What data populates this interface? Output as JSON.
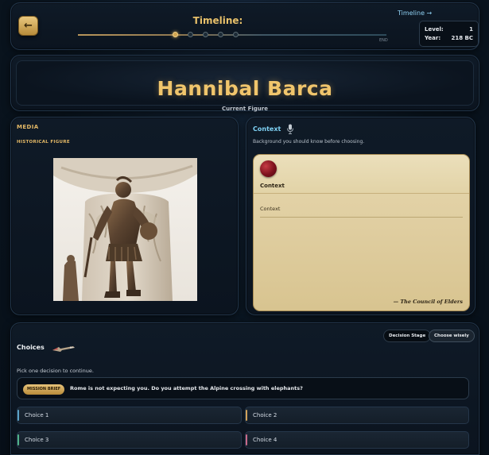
{
  "header": {
    "back_icon": "back-arrow-icon",
    "back_glyph": "←",
    "timeline_title": "Timeline:",
    "timeline_end": "END",
    "timeline_link": "Timeline →",
    "timeline_current_index": 0,
    "level_label": "Level:",
    "level_value": "1",
    "year_label": "Year:",
    "year_value": "218 BC"
  },
  "hero": {
    "name": "Hannibal Barca",
    "subtitle": "Current Figure"
  },
  "media": {
    "title": "MEDIA",
    "subtitle": "HISTORICAL FIGURE",
    "image_subject": "bronze statue of Hannibal Barca"
  },
  "context": {
    "title": "Context",
    "icon": "microphone-icon",
    "description": "Background you should know before choosing.",
    "card_title": "Context",
    "card_body": "Context",
    "signature": "— The Council of Elders",
    "seal_color": "#8e1522"
  },
  "choices": {
    "title": "Choices",
    "icon": "arrow-icon",
    "stage_label": "Decision Stage",
    "hint_label": "Choose wisely",
    "instruction": "Pick one decision to continue.",
    "brief_badge": "MISSION BRIEF",
    "brief_text": "Rome is not expecting you. Do you attempt the Alpine crossing with elephants?",
    "options": [
      {
        "label": "Choice 1",
        "accent": "#5aa2c8"
      },
      {
        "label": "Choice 2",
        "accent": "#d1a25a"
      },
      {
        "label": "Choice 3",
        "accent": "#4fb38a"
      },
      {
        "label": "Choice 4",
        "accent": "#c86a8a"
      }
    ]
  },
  "colors": {
    "accent_gold": "#f0c56c",
    "accent_cyan": "#7fd3f6",
    "background": "#0a1520"
  }
}
